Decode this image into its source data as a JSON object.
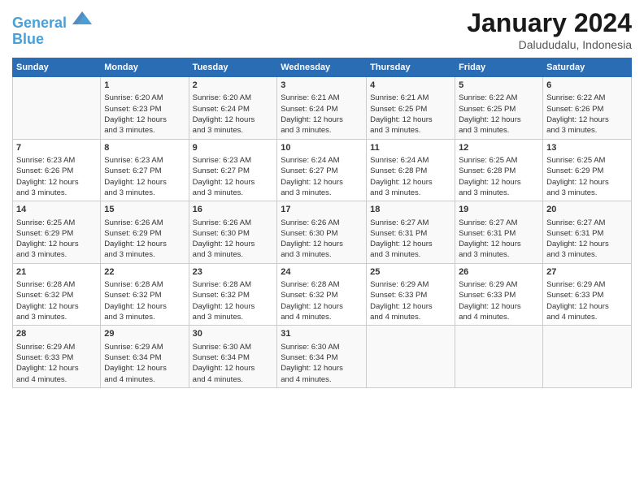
{
  "header": {
    "logo_line1": "General",
    "logo_line2": "Blue",
    "month": "January 2024",
    "location": "Dalududalu, Indonesia"
  },
  "days_of_week": [
    "Sunday",
    "Monday",
    "Tuesday",
    "Wednesday",
    "Thursday",
    "Friday",
    "Saturday"
  ],
  "weeks": [
    [
      {
        "day": "",
        "info": ""
      },
      {
        "day": "1",
        "info": "Sunrise: 6:20 AM\nSunset: 6:23 PM\nDaylight: 12 hours\nand 3 minutes."
      },
      {
        "day": "2",
        "info": "Sunrise: 6:20 AM\nSunset: 6:24 PM\nDaylight: 12 hours\nand 3 minutes."
      },
      {
        "day": "3",
        "info": "Sunrise: 6:21 AM\nSunset: 6:24 PM\nDaylight: 12 hours\nand 3 minutes."
      },
      {
        "day": "4",
        "info": "Sunrise: 6:21 AM\nSunset: 6:25 PM\nDaylight: 12 hours\nand 3 minutes."
      },
      {
        "day": "5",
        "info": "Sunrise: 6:22 AM\nSunset: 6:25 PM\nDaylight: 12 hours\nand 3 minutes."
      },
      {
        "day": "6",
        "info": "Sunrise: 6:22 AM\nSunset: 6:26 PM\nDaylight: 12 hours\nand 3 minutes."
      }
    ],
    [
      {
        "day": "7",
        "info": "Sunrise: 6:23 AM\nSunset: 6:26 PM\nDaylight: 12 hours\nand 3 minutes."
      },
      {
        "day": "8",
        "info": "Sunrise: 6:23 AM\nSunset: 6:27 PM\nDaylight: 12 hours\nand 3 minutes."
      },
      {
        "day": "9",
        "info": "Sunrise: 6:23 AM\nSunset: 6:27 PM\nDaylight: 12 hours\nand 3 minutes."
      },
      {
        "day": "10",
        "info": "Sunrise: 6:24 AM\nSunset: 6:27 PM\nDaylight: 12 hours\nand 3 minutes."
      },
      {
        "day": "11",
        "info": "Sunrise: 6:24 AM\nSunset: 6:28 PM\nDaylight: 12 hours\nand 3 minutes."
      },
      {
        "day": "12",
        "info": "Sunrise: 6:25 AM\nSunset: 6:28 PM\nDaylight: 12 hours\nand 3 minutes."
      },
      {
        "day": "13",
        "info": "Sunrise: 6:25 AM\nSunset: 6:29 PM\nDaylight: 12 hours\nand 3 minutes."
      }
    ],
    [
      {
        "day": "14",
        "info": "Sunrise: 6:25 AM\nSunset: 6:29 PM\nDaylight: 12 hours\nand 3 minutes."
      },
      {
        "day": "15",
        "info": "Sunrise: 6:26 AM\nSunset: 6:29 PM\nDaylight: 12 hours\nand 3 minutes."
      },
      {
        "day": "16",
        "info": "Sunrise: 6:26 AM\nSunset: 6:30 PM\nDaylight: 12 hours\nand 3 minutes."
      },
      {
        "day": "17",
        "info": "Sunrise: 6:26 AM\nSunset: 6:30 PM\nDaylight: 12 hours\nand 3 minutes."
      },
      {
        "day": "18",
        "info": "Sunrise: 6:27 AM\nSunset: 6:31 PM\nDaylight: 12 hours\nand 3 minutes."
      },
      {
        "day": "19",
        "info": "Sunrise: 6:27 AM\nSunset: 6:31 PM\nDaylight: 12 hours\nand 3 minutes."
      },
      {
        "day": "20",
        "info": "Sunrise: 6:27 AM\nSunset: 6:31 PM\nDaylight: 12 hours\nand 3 minutes."
      }
    ],
    [
      {
        "day": "21",
        "info": "Sunrise: 6:28 AM\nSunset: 6:32 PM\nDaylight: 12 hours\nand 3 minutes."
      },
      {
        "day": "22",
        "info": "Sunrise: 6:28 AM\nSunset: 6:32 PM\nDaylight: 12 hours\nand 3 minutes."
      },
      {
        "day": "23",
        "info": "Sunrise: 6:28 AM\nSunset: 6:32 PM\nDaylight: 12 hours\nand 3 minutes."
      },
      {
        "day": "24",
        "info": "Sunrise: 6:28 AM\nSunset: 6:32 PM\nDaylight: 12 hours\nand 4 minutes."
      },
      {
        "day": "25",
        "info": "Sunrise: 6:29 AM\nSunset: 6:33 PM\nDaylight: 12 hours\nand 4 minutes."
      },
      {
        "day": "26",
        "info": "Sunrise: 6:29 AM\nSunset: 6:33 PM\nDaylight: 12 hours\nand 4 minutes."
      },
      {
        "day": "27",
        "info": "Sunrise: 6:29 AM\nSunset: 6:33 PM\nDaylight: 12 hours\nand 4 minutes."
      }
    ],
    [
      {
        "day": "28",
        "info": "Sunrise: 6:29 AM\nSunset: 6:33 PM\nDaylight: 12 hours\nand 4 minutes."
      },
      {
        "day": "29",
        "info": "Sunrise: 6:29 AM\nSunset: 6:34 PM\nDaylight: 12 hours\nand 4 minutes."
      },
      {
        "day": "30",
        "info": "Sunrise: 6:30 AM\nSunset: 6:34 PM\nDaylight: 12 hours\nand 4 minutes."
      },
      {
        "day": "31",
        "info": "Sunrise: 6:30 AM\nSunset: 6:34 PM\nDaylight: 12 hours\nand 4 minutes."
      },
      {
        "day": "",
        "info": ""
      },
      {
        "day": "",
        "info": ""
      },
      {
        "day": "",
        "info": ""
      }
    ]
  ]
}
